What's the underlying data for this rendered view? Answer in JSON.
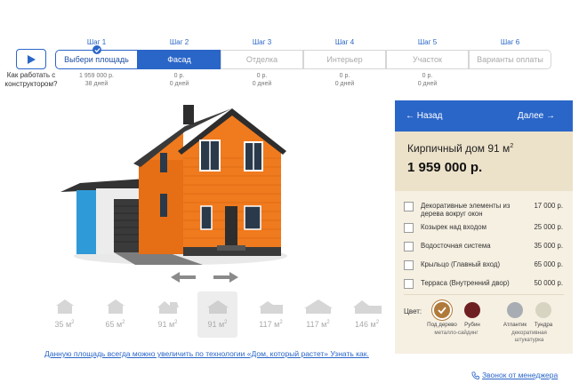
{
  "help": {
    "text": "Как работать с конструктором?"
  },
  "steps": [
    {
      "step": "Шаг 1",
      "label": "Выбери площадь",
      "price": "1 959 000 р.",
      "days": "38 дней",
      "state": "done"
    },
    {
      "step": "Шаг 2",
      "label": "Фасад",
      "price": "0 р.",
      "days": "0 дней",
      "state": "active"
    },
    {
      "step": "Шаг 3",
      "label": "Отделка",
      "price": "0 р.",
      "days": "0 дней",
      "state": "todo"
    },
    {
      "step": "Шаг 4",
      "label": "Интерьер",
      "price": "0 р.",
      "days": "0 дней",
      "state": "todo"
    },
    {
      "step": "Шаг 5",
      "label": "Участок",
      "price": "0 р.",
      "days": "0 дней",
      "state": "todo"
    },
    {
      "step": "Шаг 6",
      "label": "Варианты оплаты",
      "price": "",
      "days": "",
      "state": "todo"
    }
  ],
  "thumbs": [
    {
      "area": "35 м",
      "sup": "2",
      "selected": false
    },
    {
      "area": "65 м",
      "sup": "2",
      "selected": false
    },
    {
      "area": "91 м",
      "sup": "2",
      "selected": false
    },
    {
      "area": "91 м",
      "sup": "2",
      "selected": true
    },
    {
      "area": "117 м",
      "sup": "2",
      "selected": false
    },
    {
      "area": "117 м",
      "sup": "2",
      "selected": false
    },
    {
      "area": "146 м",
      "sup": "2",
      "selected": false
    }
  ],
  "grow_link": "Данную площадь всегда можно увеличить по технологии «Дом, который растет» Узнать как.",
  "panel": {
    "back": "← Назад",
    "next": "Далее →",
    "house_name": "Кирпичный дом 91 м",
    "house_name_sup": "2",
    "price": "1 959 000 р.",
    "options": [
      {
        "label": "Декоративные элементы из дерева вокруг окон",
        "price": "17 000 р."
      },
      {
        "label": "Козырек над входом",
        "price": "25 000 р."
      },
      {
        "label": "Водосточная система",
        "price": "35 000 р."
      },
      {
        "label": "Крыльцо (Главный вход)",
        "price": "65 000 р."
      },
      {
        "label": "Терраса (Внутренний двор)",
        "price": "50 000 р."
      }
    ],
    "color_label": "Цвет:",
    "colors": [
      {
        "name": "Под дерево",
        "hex": "#b07a3a",
        "selected": true
      },
      {
        "name": "Рубин",
        "hex": "#6e1f22",
        "selected": false
      },
      {
        "name": "Атлантик",
        "hex": "#a7adb3",
        "selected": false
      },
      {
        "name": "Тундра",
        "hex": "#d8d4c2",
        "selected": false
      }
    ],
    "group1": "металло-сайдинг",
    "group2": "декоративная штукатурка"
  },
  "callback": "Звонок от менеджера",
  "colors": {
    "accent": "#2a66c8",
    "facade": "#f07a1e",
    "panel_bg": "#f6f0e3"
  }
}
